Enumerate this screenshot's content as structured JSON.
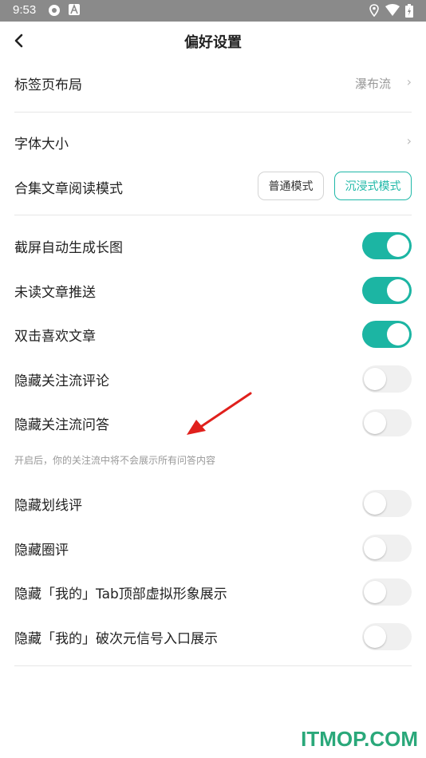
{
  "status_bar": {
    "time": "9:53",
    "icons_left": [
      "aperture-icon",
      "a-icon"
    ],
    "icons_right": [
      "location-icon",
      "wifi-icon",
      "battery-icon"
    ]
  },
  "header": {
    "back_icon": "chevron-left-icon",
    "title": "偏好设置"
  },
  "settings": {
    "tab_layout": {
      "label": "标签页布局",
      "value": "瀑布流"
    },
    "font_size": {
      "label": "字体大小"
    },
    "read_mode": {
      "label": "合集文章阅读模式",
      "options": [
        "普通模式",
        "沉浸式模式"
      ],
      "selected": "沉浸式模式"
    },
    "toggles": [
      {
        "label": "截屏自动生成长图",
        "on": true
      },
      {
        "label": "未读文章推送",
        "on": true
      },
      {
        "label": "双击喜欢文章",
        "on": true
      },
      {
        "label": "隐藏关注流评论",
        "on": false
      },
      {
        "label": "隐藏关注流问答",
        "on": false
      },
      {
        "label": "隐藏划线评",
        "on": false
      },
      {
        "label": "隐藏圈评",
        "on": false
      },
      {
        "label": "隐藏「我的」Tab顶部虚拟形象展示",
        "on": false
      },
      {
        "label": "隐藏「我的」破次元信号入口展示",
        "on": false
      }
    ],
    "qa_note": "开启后，你的关注流中将不会展示所有问答内容"
  },
  "colors": {
    "accent": "#1cb5a3",
    "arrow": "#e0201c",
    "watermark": "#2aa87a"
  },
  "watermark": "ITMOP.COM"
}
